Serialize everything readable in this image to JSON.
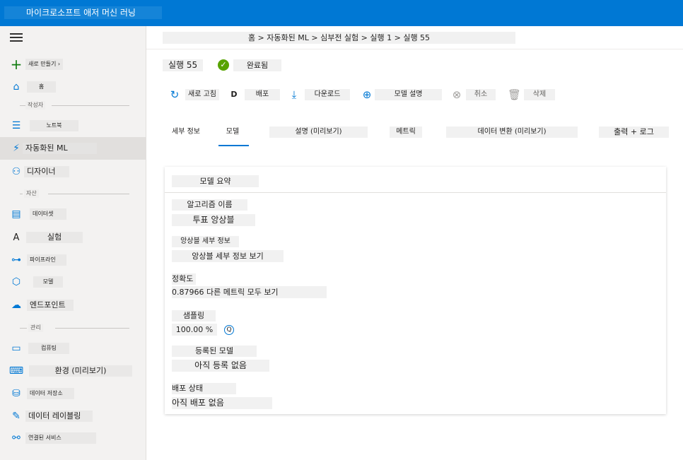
{
  "app": {
    "title": "마이크로소프트 애저 머신 러닝"
  },
  "sidebar": {
    "new_label": "새로 만들기 ›",
    "home_label": "홈",
    "section_author": "작성자",
    "notebook_label": "노트북",
    "automl_label": "자동화된 ML",
    "designer_label": "디자이너",
    "section_assets": "자산",
    "datasets_label": "데이터셋",
    "experiments_label": "실험",
    "pipelines_label": "파이프라인",
    "models_label": "모델",
    "endpoints_label": "엔드포인트",
    "section_manage": "관리",
    "compute_label": "컴퓨팅",
    "environments_label": "환경 (미리보기)",
    "datastores_label": "데이터 저장소",
    "labeling_label": "데이터 레이블링",
    "linked_services_label": "연결된 서비스"
  },
  "breadcrumb": {
    "text": "홈 > 자동화된 ML > 심부전 실험 > 실행 1 > 실행 55"
  },
  "run": {
    "title": "실행 55",
    "status": "완료됨"
  },
  "toolbar": {
    "refresh": "새로 고침",
    "deploy_icon_text": "D",
    "deploy": "배포",
    "download": "다운로드",
    "explain": "모델 설명",
    "cancel": "취소",
    "delete": "삭제"
  },
  "tabs": {
    "details": "세부 정보",
    "model": "모델",
    "explanations": "설명 (미리보기)",
    "metrics": "메트릭",
    "data_transform": "데이터 변환 (미리보기)",
    "outputs": "출력 + 로그"
  },
  "model_summary": {
    "title": "모델 요약",
    "algorithm_label": "알고리즘 이름",
    "algorithm_value": "투표 앙상블",
    "ensemble_label": "앙상블 세부 정보",
    "ensemble_value": "앙상블 세부 정보 보기",
    "accuracy_label": "정확도",
    "accuracy_value": "0.87966 다른 메트릭 모두 보기",
    "sampling_label": "샘플링",
    "sampling_value": "100.00 %",
    "sampling_icon_text": "Q",
    "registered_label": "등록된 모델",
    "registered_value": "아직 등록 없음",
    "deploy_status_label": "배포 상태",
    "deploy_status_value": "아직 배포 없음"
  },
  "icons": {
    "accent": "#0078d4",
    "success": "#57a300",
    "header_bg": "#0078d4"
  }
}
